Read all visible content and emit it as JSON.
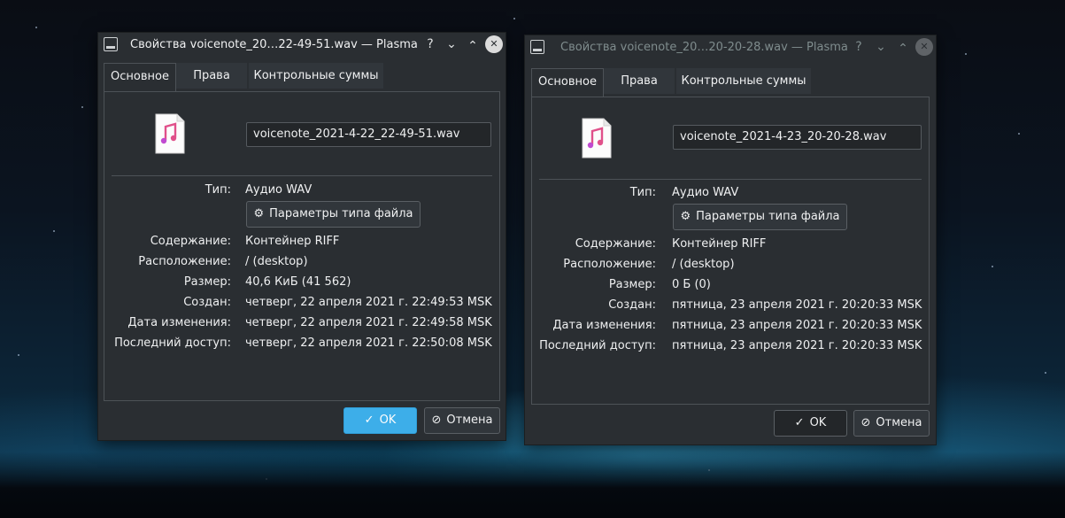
{
  "windows": [
    {
      "title": "Свойства voicenote_20…22-49-51.wav — Plasma",
      "focused": true,
      "tabs": [
        "Основное",
        "Права",
        "Контрольные суммы"
      ],
      "filename": "voicenote_2021-4-22_22-49-51.wav",
      "file_type_button": "Параметры типа файла",
      "rows": [
        {
          "label": "Тип:",
          "value": "Аудио WAV"
        },
        {
          "label": "Содержание:",
          "value": "Контейнер RIFF"
        },
        {
          "label": "Расположение:",
          "value": "/ (desktop)"
        },
        {
          "label": "Размер:",
          "value": "40,6 КиБ (41 562)"
        },
        {
          "label": "Создан:",
          "value": "четверг, 22 апреля 2021 г. 22:49:53 MSK"
        },
        {
          "label": "Дата изменения:",
          "value": "четверг, 22 апреля 2021 г. 22:49:58 MSK"
        },
        {
          "label": "Последний доступ:",
          "value": "четверг, 22 апреля 2021 г. 22:50:08 MSK"
        }
      ],
      "ok": "OK",
      "cancel": "Отмена"
    },
    {
      "title": "Свойства voicenote_20…20-20-28.wav — Plasma",
      "focused": false,
      "tabs": [
        "Основное",
        "Права",
        "Контрольные суммы"
      ],
      "filename": "voicenote_2021-4-23_20-20-28.wav",
      "file_type_button": "Параметры типа файла",
      "rows": [
        {
          "label": "Тип:",
          "value": "Аудио WAV"
        },
        {
          "label": "Содержание:",
          "value": "Контейнер RIFF"
        },
        {
          "label": "Расположение:",
          "value": "/ (desktop)"
        },
        {
          "label": "Размер:",
          "value": "0 Б (0)"
        },
        {
          "label": "Создан:",
          "value": "пятница, 23 апреля 2021 г. 20:20:33 MSK"
        },
        {
          "label": "Дата изменения:",
          "value": "пятница, 23 апреля 2021 г. 20:20:33 MSK"
        },
        {
          "label": "Последний доступ:",
          "value": "пятница, 23 апреля 2021 г. 20:20:33 MSK"
        }
      ],
      "ok": "OK",
      "cancel": "Отмена"
    }
  ],
  "colors": {
    "accent": "#3daee9",
    "window_bg": "#2a2e32",
    "close_active": "#dcdcdc",
    "close_inactive": "#5f6367",
    "title_active": "#eff0f1",
    "title_inactive": "#7f8c8d"
  },
  "icons": [
    "app-icon",
    "help-icon",
    "minimize-icon",
    "maximize-icon",
    "close-icon",
    "audio-file-icon",
    "settings-icon",
    "check-icon",
    "cancel-icon"
  ]
}
